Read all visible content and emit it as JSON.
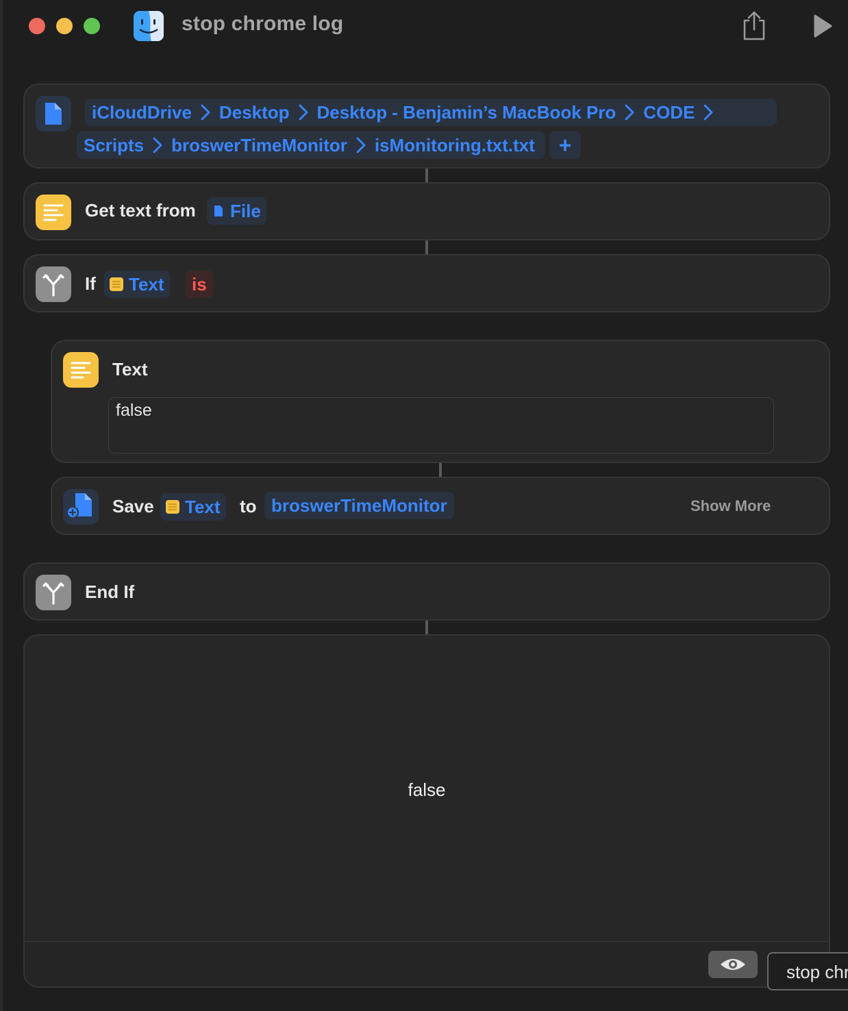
{
  "window": {
    "title": "stop chrome log"
  },
  "actions": {
    "file": {
      "path_row1": [
        "iCloudDrive",
        "Desktop",
        "Desktop - Benjamin’s MacBook Pro",
        "CODE"
      ],
      "path_row2": [
        "Scripts",
        "broswerTimeMonitor",
        "isMonitoring.txt.txt"
      ],
      "add_label": "+"
    },
    "get_text": {
      "label": "Get text from",
      "input_token": "File"
    },
    "if": {
      "label": "If",
      "input_token": "Text",
      "condition": "is"
    },
    "text": {
      "label": "Text",
      "value": "false"
    },
    "save": {
      "label": "Save",
      "input_token": "Text",
      "to_label": "to",
      "destination": "broswerTimeMonitor",
      "show_more": "Show More"
    },
    "end_if": {
      "label": "End If"
    }
  },
  "result": {
    "value": "false",
    "tab_label": "stop chrome log"
  },
  "colors": {
    "accent": "#3a86ff",
    "text_icon": "#f6c244",
    "condition": "#ff5c52"
  },
  "icons": [
    "finder-app-icon",
    "share-icon",
    "run-icon",
    "file-icon",
    "text-icon",
    "if-branch-icon",
    "save-file-icon",
    "eye-icon",
    "chevron-right-icon"
  ]
}
